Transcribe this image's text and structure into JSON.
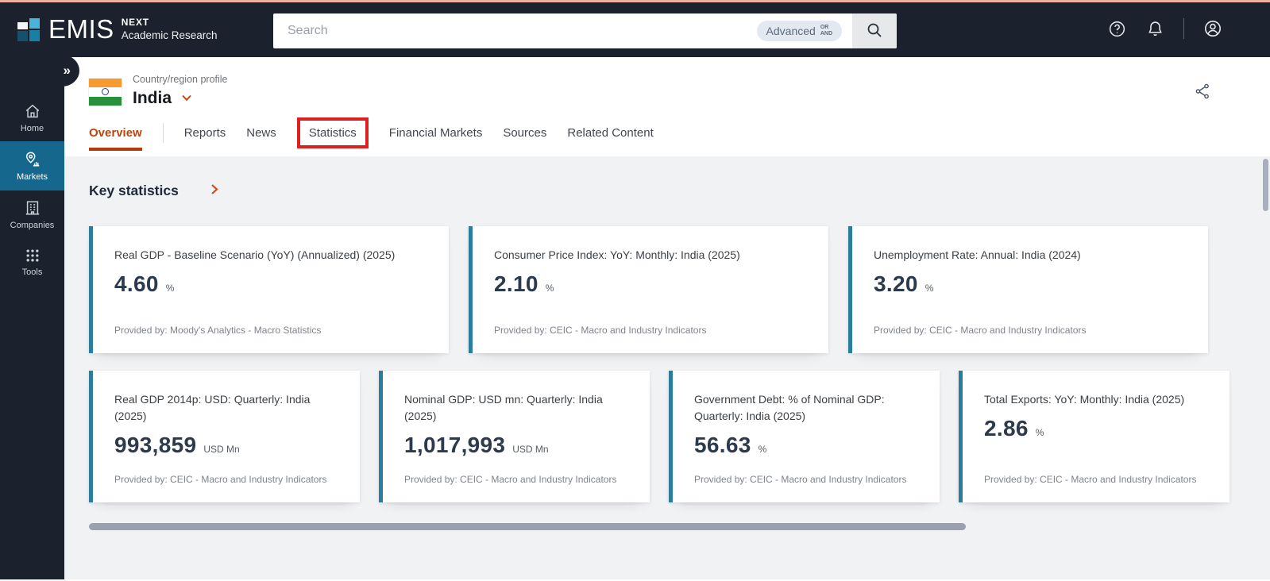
{
  "header": {
    "brand": "EMIS",
    "brand_next": "NEXT",
    "brand_sub": "Academic Research",
    "search_placeholder": "Search",
    "advanced_label": "Advanced",
    "advanced_or": "OR",
    "advanced_and": "AND",
    "icons": [
      "help-icon",
      "notifications-icon",
      "account-icon"
    ]
  },
  "sidebar": {
    "expand_glyph": "»",
    "items": [
      {
        "label": "Home",
        "icon": "home-icon",
        "active": false
      },
      {
        "label": "Markets",
        "icon": "markets-icon",
        "active": true
      },
      {
        "label": "Companies",
        "icon": "companies-icon",
        "active": false
      },
      {
        "label": "Tools",
        "icon": "tools-grid-icon",
        "active": false
      }
    ]
  },
  "profile": {
    "kicker": "Country/region profile",
    "title": "India",
    "tabs": [
      {
        "label": "Overview",
        "active": true
      },
      {
        "label": "Reports"
      },
      {
        "label": "News"
      },
      {
        "label": "Statistics",
        "annotated": true
      },
      {
        "label": "Financial Markets"
      },
      {
        "label": "Sources"
      },
      {
        "label": "Related Content"
      }
    ]
  },
  "main": {
    "section_title": "Key statistics",
    "rows": [
      {
        "cards": [
          {
            "title": "Real GDP - Baseline Scenario (YoY) (Annualized) (2025)",
            "value": "4.60",
            "unit": "%",
            "provider": "Provided by: Moody's Analytics - Macro Statistics"
          },
          {
            "title": "Consumer Price Index: YoY: Monthly: India (2025)",
            "value": "2.10",
            "unit": "%",
            "provider": "Provided by: CEIC - Macro and Industry Indicators"
          },
          {
            "title": "Unemployment Rate: Annual: India (2024)",
            "value": "3.20",
            "unit": "%",
            "provider": "Provided by: CEIC - Macro and Industry Indicators"
          }
        ]
      },
      {
        "cards": [
          {
            "title": "Real GDP 2014p: USD: Quarterly: India (2025)",
            "value": "993,859",
            "unit": "USD Mn",
            "provider": "Provided by: CEIC - Macro and Industry Indicators"
          },
          {
            "title": "Nominal GDP: USD mn: Quarterly: India (2025)",
            "value": "1,017,993",
            "unit": "USD Mn",
            "provider": "Provided by: CEIC - Macro and Industry Indicators"
          },
          {
            "title": "Government Debt: % of Nominal GDP: Quarterly: India (2025)",
            "value": "56.63",
            "unit": "%",
            "provider": "Provided by: CEIC - Macro and Industry Indicators"
          },
          {
            "title": "Total Exports: YoY: Monthly: India (2025)",
            "value": "2.86",
            "unit": "%",
            "provider": "Provided by: CEIC - Macro and Industry Indicators"
          }
        ]
      }
    ]
  },
  "colors": {
    "topbar": "#1c222d",
    "sidebar_active": "#15678d",
    "card_accent": "#2b7d9d",
    "accent_orange": "#c0430d",
    "annotation_red": "#de1f1f",
    "background_gray": "#f1f2f4"
  }
}
